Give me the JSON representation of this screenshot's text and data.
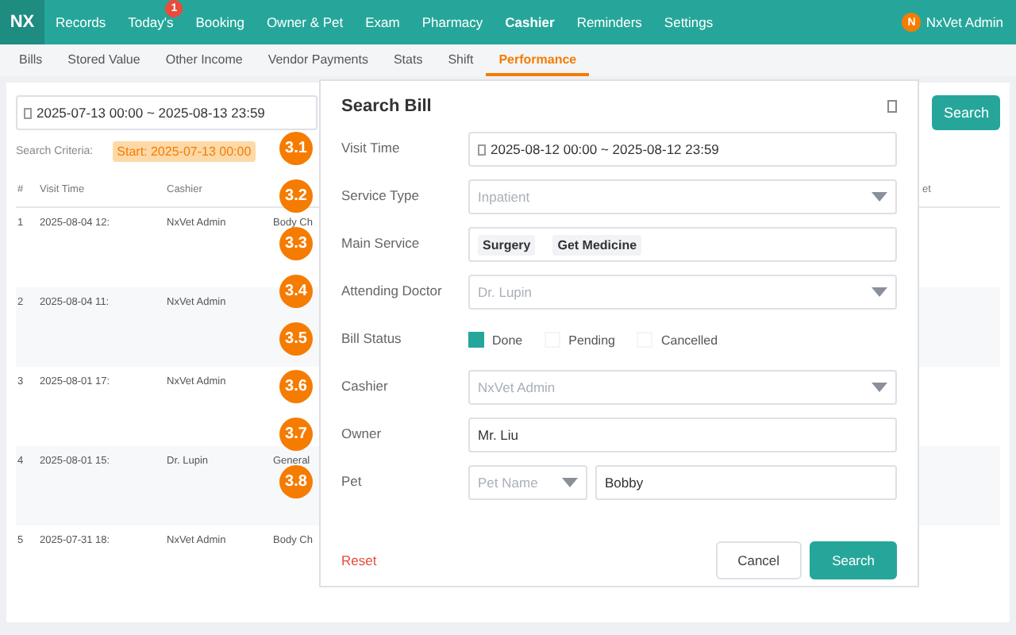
{
  "nav": {
    "logo": "NX",
    "items": [
      {
        "label": "Records",
        "selected": false
      },
      {
        "label": "Today's",
        "selected": false,
        "badge": "1"
      },
      {
        "label": "Booking",
        "selected": false
      },
      {
        "label": "Owner & Pet",
        "selected": false
      },
      {
        "label": "Exam",
        "selected": false
      },
      {
        "label": "Pharmacy",
        "selected": false
      },
      {
        "label": "Cashier",
        "selected": true
      },
      {
        "label": "Reminders",
        "selected": false
      },
      {
        "label": "Settings",
        "selected": false
      }
    ],
    "user": {
      "initial": "N",
      "name": "NxVet Admin"
    }
  },
  "subtabs": [
    {
      "label": "Bills",
      "selected": false
    },
    {
      "label": "Stored Value",
      "selected": false
    },
    {
      "label": "Other Income",
      "selected": false
    },
    {
      "label": "Vendor Payments",
      "selected": false
    },
    {
      "label": "Stats",
      "selected": false
    },
    {
      "label": "Shift",
      "selected": false
    },
    {
      "label": "Performance",
      "selected": true
    }
  ],
  "toolbar": {
    "date_range": "2025-07-13 00:00 ~ 2025-08-13 23:59",
    "search_button": "Search"
  },
  "criteria": {
    "label": "Search Criteria:",
    "tags": [
      "Start: 2025-07-13 00:00"
    ]
  },
  "table": {
    "columns": [
      "#",
      "Visit Time",
      "Cashier"
    ],
    "column_5_header": "et",
    "rows": [
      {
        "cells": [
          "1",
          "2025-08-04 12:",
          "NxVet Admin",
          "Body Ch"
        ]
      },
      {
        "cells": [
          "2",
          "2025-08-04 11:",
          "NxVet Admin"
        ]
      },
      {
        "cells": [
          "3",
          "2025-08-01 17:",
          "NxVet Admin"
        ]
      },
      {
        "cells": [
          "4",
          "2025-08-01 15:",
          "Dr. Lupin",
          "General"
        ]
      },
      {
        "cells": [
          "5",
          "2025-07-31 18:",
          "NxVet Admin",
          "Body Ch"
        ]
      }
    ]
  },
  "modal": {
    "title": "Search Bill",
    "fields": [
      {
        "label": "Visit Time",
        "kind": "daterange",
        "value": "2025-08-12 00:00 ~ 2025-08-12 23:59"
      },
      {
        "label": "Service Type",
        "kind": "select",
        "placeholder": "Inpatient"
      },
      {
        "label": "Main Service",
        "kind": "tags",
        "tags": [
          "Surgery",
          "Get Medicine"
        ]
      },
      {
        "label": "Attending Doctor",
        "kind": "select",
        "placeholder": "Dr. Lupin"
      },
      {
        "label": "Bill Status",
        "kind": "checks",
        "options": [
          {
            "label": "Done",
            "checked": true
          },
          {
            "label": "Pending",
            "checked": false
          },
          {
            "label": "Cancelled",
            "checked": false
          }
        ]
      },
      {
        "label": "Cashier",
        "kind": "select",
        "placeholder": "NxVet Admin"
      },
      {
        "label": "Owner",
        "kind": "input",
        "value": "Mr. Liu"
      },
      {
        "label": "Pet",
        "kind": "pet",
        "select_placeholder": "Pet Name",
        "value": "Bobby"
      }
    ],
    "reset": "Reset",
    "cancel": "Cancel",
    "search": "Search"
  },
  "annotations": [
    "3.1",
    "3.2",
    "3.3",
    "3.4",
    "3.5",
    "3.6",
    "3.7",
    "3.8"
  ]
}
